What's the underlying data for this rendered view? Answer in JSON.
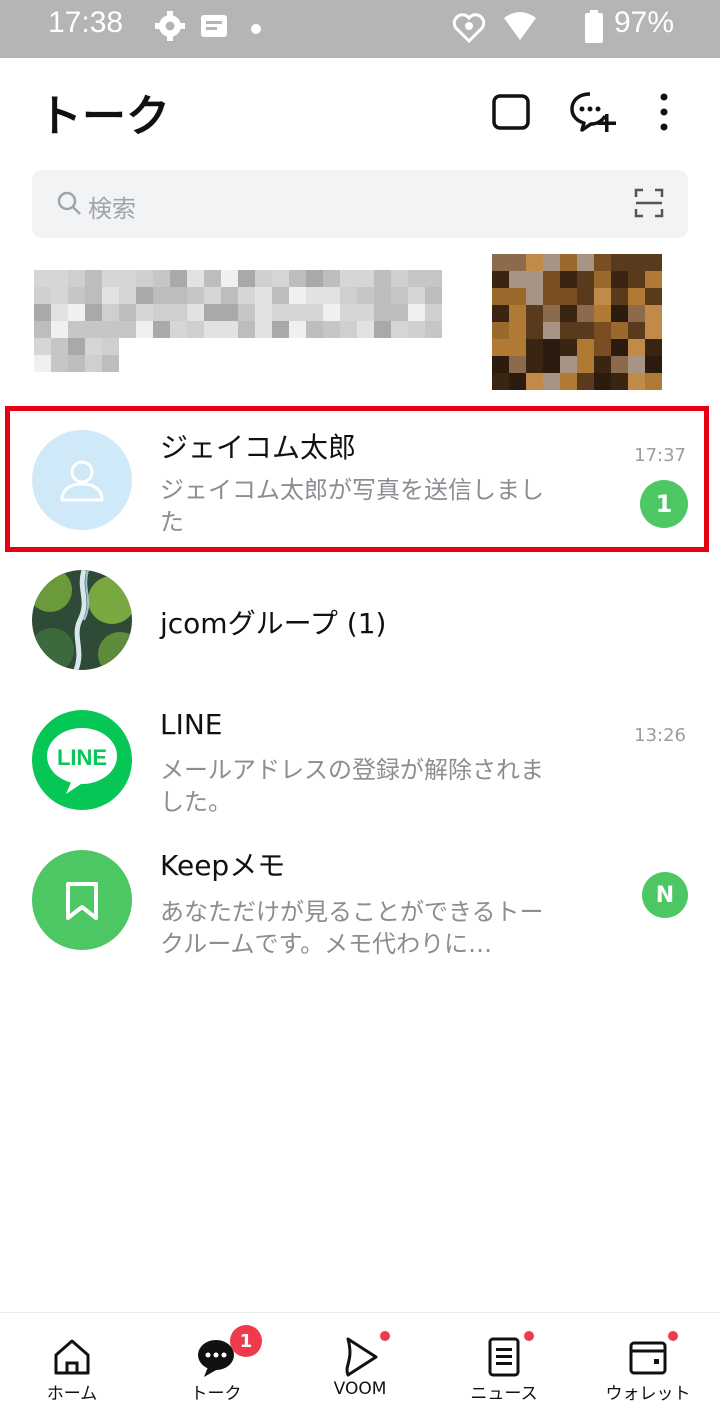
{
  "status_bar": {
    "time": "17:38",
    "battery": "97%",
    "icons": [
      "gear-icon",
      "notification-icon",
      "dot-icon",
      "vpn-icon",
      "wifi-icon",
      "battery-icon"
    ]
  },
  "header": {
    "title": "トーク",
    "actions": [
      "open-chat-icon",
      "new-chat-icon",
      "more-icon"
    ]
  },
  "search": {
    "placeholder": "検索"
  },
  "chats": [
    {
      "name": "ジェイコム太郎",
      "preview": "ジェイコム太郎が写真を送信しました",
      "time": "17:37",
      "badge": "1",
      "avatar": "default-person-icon",
      "highlighted": true
    },
    {
      "name": "jcomグループ (1)",
      "preview": "",
      "time": "",
      "badge": "",
      "avatar": "waterfall-photo"
    },
    {
      "name": "LINE",
      "preview": "メールアドレスの登録が解除されました。",
      "time": "13:26",
      "badge": "",
      "avatar": "line-logo"
    },
    {
      "name": "Keepメモ",
      "preview": "あなただけが見ることができるトークルームです。メモ代わりに…",
      "time": "",
      "badge": "N",
      "avatar": "bookmark-icon"
    }
  ],
  "line_logo_text": "LINE",
  "bottom_nav": [
    {
      "label": "ホーム",
      "icon": "home-icon",
      "badge": ""
    },
    {
      "label": "トーク",
      "icon": "talk-icon",
      "badge": "1"
    },
    {
      "label": "VOOM",
      "icon": "voom-icon",
      "badge": "dot"
    },
    {
      "label": "ニュース",
      "icon": "news-icon",
      "badge": "dot"
    },
    {
      "label": "ウォレット",
      "icon": "wallet-icon",
      "badge": "dot"
    }
  ],
  "colors": {
    "accent_green": "#4cc764",
    "highlight_red": "#e60012",
    "badge_red": "#ee3b4c"
  }
}
